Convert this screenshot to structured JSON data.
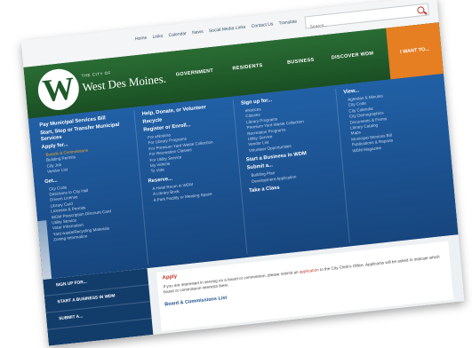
{
  "util": {
    "links": [
      "Home",
      "Links",
      "Calendar",
      "News",
      "Social Media Links",
      "Contact Us",
      "Translate"
    ],
    "search_placeholder": "Search..."
  },
  "header": {
    "logo_small": "THE CITY OF",
    "logo_name": "West Des Moines.",
    "nav": [
      "GOVERNMENT",
      "RESIDENTS",
      "BUSINESS",
      "DISCOVER WDM",
      "I WANT TO..."
    ]
  },
  "mega": {
    "col1": {
      "head1": "Pay Municipal Services Bill",
      "head2": "Start, Stop or Transfer Municipal Services",
      "head3": "Apply for...",
      "apply_items": [
        "Boards & Commissions",
        "Building Permits",
        "City Job",
        "Vendor List"
      ],
      "head4": "Get...",
      "get_items": [
        "City Code",
        "Directions to City Hall",
        "Drivers License",
        "Library Card",
        "Licenses & Permits",
        "WDM Prescription Discount Card",
        "Utility Service",
        "Voter Information",
        "Yard waste/Recycling Materials",
        "Zoning Information"
      ]
    },
    "col2": {
      "head1": "Help, Donate, or Volunteer",
      "head1b": "Recycle",
      "head2": "Register or Enroll...",
      "enroll_items": [
        "For eNotices",
        "For Library Programs",
        "For Premium Yard Waste Collection",
        "For Recreation Classes",
        "For Utility Service",
        "My Vehicle",
        "To Vote"
      ],
      "head3": "Reserve...",
      "reserve_items": [
        "A Hotel Room in WDM",
        "A Library Book",
        "A Park Facility or Meeting Space"
      ]
    },
    "col3": {
      "head1": "Sign up for...",
      "signup_items": [
        "eNotices",
        "Classes",
        "Library Programs",
        "Premium Yard Waste Collection",
        "Recreation Programs",
        "Utility Service",
        "Vendor List",
        "Volunteer Opportunities"
      ],
      "head2": "Start a Business in WDM",
      "head3": "Submit a...",
      "submit_items": [
        "Building Plan",
        "Development Application"
      ],
      "head4": "Take a Class"
    },
    "col4": {
      "head1": "View...",
      "view_items": [
        "Agendas & Minutes",
        "City Code",
        "City Calendar",
        "City Demographics",
        "Documents & Forms",
        "Library Catalog",
        "Maps",
        "Municipal Services Bill",
        "Publications & Reports",
        "WDM Magazine"
      ]
    }
  },
  "leftnav": [
    "SIGN UP FOR...",
    "START A BUSINESS IN WDM",
    "SUBMIT A..."
  ],
  "content": {
    "title": "Apply",
    "text_before": "If you are interested in serving on a board or commission, please submit an ",
    "link": "application",
    "text_after": " to the City Clerk's Office. Applicants will be asked to indicate which board or commission interests them.",
    "subhead": "Board & Commissions List"
  }
}
